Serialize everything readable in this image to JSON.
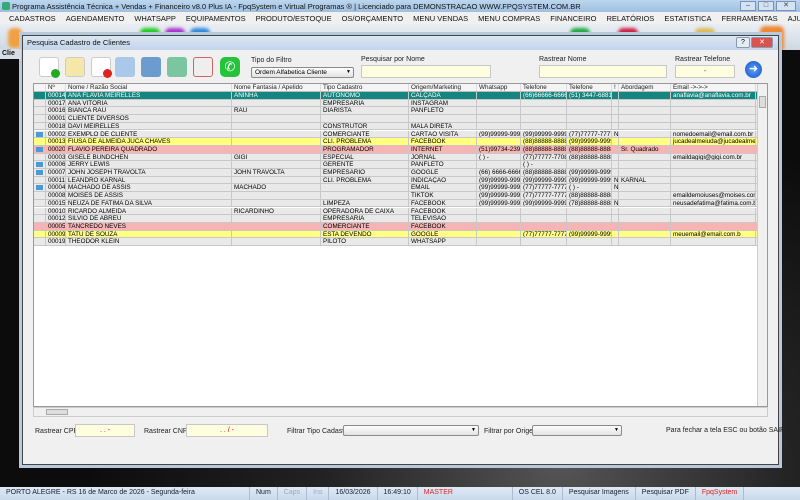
{
  "app": {
    "title": "Programa Assistência Técnica + Vendas + Financeiro v8.0 Plus IA - FpqSystem e Virtual Programas ® | Licenciado para  DEMONSTRACAO WWW.FPQSYSTEM.COM.BR",
    "minimize": "–",
    "maximize": "□",
    "close": "✕"
  },
  "menu": [
    "CADASTROS",
    "AGENDAMENTO",
    "WHATSAPP",
    "EQUIPAMENTOS",
    "PRODUTO/ESTOQUE",
    "OS/ORÇAMENTO",
    "MENU VENDAS",
    "MENU COMPRAS",
    "FINANCEIRO",
    "RELATÓRIOS",
    "ESTATISTICA",
    "FERRAMENTAS",
    "AJUDA"
  ],
  "apptoolbar": {
    "first_label": "Clie"
  },
  "dialog": {
    "title": "Pesquisa Cadastro de Clientes",
    "help": "?",
    "close": "✕",
    "toolbar_icons": [
      "add-document-icon",
      "edit-document-icon",
      "delete-document-icon",
      "print-icon",
      "contacts-icon",
      "image-icon",
      "email-icon",
      "whatsapp-icon"
    ],
    "filter_type_label": "Tipo do Filtro",
    "filter_type_value": "Ordem Alfabetica Cliente",
    "search_name_label": "Pesquisar por Nome",
    "search_name_value": "",
    "track_name_label": "Rastrear Nome",
    "track_name_value": "",
    "track_phone_label": "Rastrear Telefone",
    "track_phone_value": "-",
    "track_cpf_label": "Rastrear CPF",
    "track_cpf_value": ". .  -",
    "track_cnpj_label": "Rastrear CNPJ",
    "track_cnpj_value": ". . /  -",
    "filter_tipo_label": "Filtrar Tipo Cadastro",
    "filter_tipo_value": "",
    "filter_origem_label": "Filtrar por Origem",
    "filter_origem_value": "",
    "close_hint": "Para fechar a tela ESC ou botão SAIR"
  },
  "grid": {
    "columns": [
      "",
      "Nº",
      "Nome / Razão Social",
      "Nome Fantasia / Apelido",
      "Tipo Cadastro",
      "Origem/Marketing",
      "Whatsapp",
      "Telefone",
      "Telefone",
      "!",
      "Abordagem",
      "Email ->->->"
    ],
    "rows": [
      {
        "style": "selected",
        "icon": false,
        "cells": [
          "00014",
          "ANA FLAVIA MEIRELLES",
          "ANINHA",
          "AUTONOMO",
          "CALÇADA",
          "",
          "(66)66666-6666",
          "(51) 3447-6881",
          "",
          "",
          "anaflavia@anaflavia.com.br"
        ]
      },
      {
        "style": "",
        "icon": false,
        "cells": [
          "00017",
          "ANA VITÓRIA",
          "",
          "EMPRESARIA",
          "INSTAGRAM",
          "",
          "",
          "",
          "",
          "",
          ""
        ]
      },
      {
        "style": "",
        "icon": false,
        "cells": [
          "00016",
          "BIANCA RAU",
          "RAU",
          "DIARISTA",
          "PANFLETO",
          "",
          "",
          "",
          "",
          "",
          ""
        ]
      },
      {
        "style": "",
        "icon": false,
        "cells": [
          "00001",
          "CLIENTE DIVERSOS",
          "",
          "",
          "",
          "",
          "",
          "",
          "",
          "",
          ""
        ]
      },
      {
        "style": "",
        "icon": false,
        "cells": [
          "00018",
          "DAVI MEIRELLES",
          "",
          "CONSTRUTOR",
          "MALA DIRETA",
          "",
          "",
          "",
          "",
          "",
          ""
        ]
      },
      {
        "style": "",
        "icon": true,
        "cells": [
          "00002",
          "EXEMPLO DE CLIENTE",
          "",
          "COMERCIANTE",
          "CARTÃO VISITA",
          "(99)99999-9999",
          "(99)99999-9999",
          "(77)77777-7777",
          "N",
          "",
          "nomedoemail@email.com.br"
        ]
      },
      {
        "style": "yellow",
        "icon": false,
        "cells": [
          "00013",
          "FIUSA DE ALMEIDA JUCA CHAVES",
          "",
          "CLI. PROBLEMA",
          "FACEBOOK",
          "",
          "(88)88888-8888",
          "(99)99999-9999",
          "",
          "",
          "jucadealmeiuda@jucadealmeida"
        ]
      },
      {
        "style": "pink",
        "icon": true,
        "cells": [
          "00020",
          "FLAVIO PEREIRA QUADRADO",
          "",
          "PROGRAMADOR",
          "INTERNET",
          "(51)99734-2390",
          "(88)88888-8888",
          "(88)88888-8888",
          "",
          "Sr. Quadrado",
          ""
        ]
      },
      {
        "style": "",
        "icon": false,
        "cells": [
          "00003",
          "GISELE BUNDCHEN",
          "GIGI",
          "ESPECIAL",
          "JORNAL",
          "(  )     -",
          "(77)77777-7708",
          "(88)88888-8888",
          "",
          "",
          "emaildagigi@gigi.com.br"
        ]
      },
      {
        "style": "",
        "icon": true,
        "cells": [
          "00006",
          "JERRY LEWIS",
          "",
          "GERENTE",
          "PANFLETO",
          "",
          "(  )     -",
          "",
          "",
          "",
          ""
        ]
      },
      {
        "style": "",
        "icon": true,
        "cells": [
          "00007",
          "JOHN JOSEPH TRAVOLTA",
          "JOHN TRAVOLTA",
          "EMPRESARIO",
          "GOOGLE",
          "(66) 6666-6666",
          "(88)88888-8888",
          "(99)99999-9999",
          "",
          "",
          ""
        ]
      },
      {
        "style": "",
        "icon": false,
        "cells": [
          "00011",
          "LEANDRO KARNAL",
          "",
          "CLI. PROBLEMA",
          "INDICAÇÃO",
          "(99)99999-9999",
          "(99)99999-9999",
          "(99)99999-9999",
          "N",
          "KARNAL",
          ""
        ]
      },
      {
        "style": "",
        "icon": true,
        "cells": [
          "00004",
          "MACHADO DE ASSIS",
          "MACHADO",
          "",
          "EMAIL",
          "(99)99999-9999",
          "(77)77777-7777",
          "(  )     -",
          "N",
          "",
          ""
        ]
      },
      {
        "style": "",
        "icon": false,
        "cells": [
          "00008",
          "MOISES DE ASSIS",
          "",
          "",
          "TIKTOK",
          "(99)99999-9999",
          "(77)77777-7777",
          "(88)88888-8888",
          "",
          "",
          "emaildemoiuses@moises.com.b"
        ]
      },
      {
        "style": "",
        "icon": false,
        "cells": [
          "00015",
          "NEUZA DE FATIMA DA SILVA",
          "",
          "LIMPEZA",
          "FACEBOOK",
          "(99)99999-9999",
          "(99)99999-9999",
          "(78)88888-8888",
          "N",
          "",
          "neusadefatima@fatima.com.br"
        ]
      },
      {
        "style": "",
        "icon": false,
        "cells": [
          "00010",
          "RICARDO ALMEIDA",
          "RICARDINHO",
          "OPERADORA DE CAIXA",
          "FACEBOOK",
          "",
          "",
          "",
          "",
          "",
          ""
        ]
      },
      {
        "style": "",
        "icon": false,
        "cells": [
          "00012",
          "SILVIO DE ABREU",
          "",
          "EMPRESARIA",
          "TELEVISÃO",
          "",
          "",
          "",
          "",
          "",
          ""
        ]
      },
      {
        "style": "pink",
        "icon": false,
        "cells": [
          "00005",
          "TANCREDO NEVES",
          "",
          "COMERCIANTE",
          "FACEBOOK",
          "",
          "",
          "",
          "",
          "",
          ""
        ]
      },
      {
        "style": "yellow",
        "icon": false,
        "cells": [
          "00009",
          "TATU DE SOUZA",
          "",
          "ESTA DEVENDO",
          "GOOGLE",
          "",
          "(77)77777-7777",
          "(99)99999-9999",
          "",
          "",
          "meuemail@email.com.b"
        ]
      },
      {
        "style": "",
        "icon": false,
        "cells": [
          "00019",
          "THEODOR KLEIN",
          "",
          "PILOTO",
          "WHATSAPP",
          "",
          "",
          "",
          "",
          "",
          ""
        ]
      }
    ]
  },
  "statusbar": [
    "PORTO ALEGRE - RS 16 de Marco de 2026 - Segunda-feira",
    "Num",
    "Caps",
    "Ins",
    "16/03/2026",
    "16:49:10",
    "MASTER",
    "OS CEL 8.0",
    "Pesquisar Imagens",
    "Pesquisar PDF",
    "FpqSystem"
  ],
  "colors": {
    "selected": "#14857f",
    "yellow": "#ffff80",
    "pink": "#f8b4b4",
    "whatsapp": "#25c33a"
  }
}
